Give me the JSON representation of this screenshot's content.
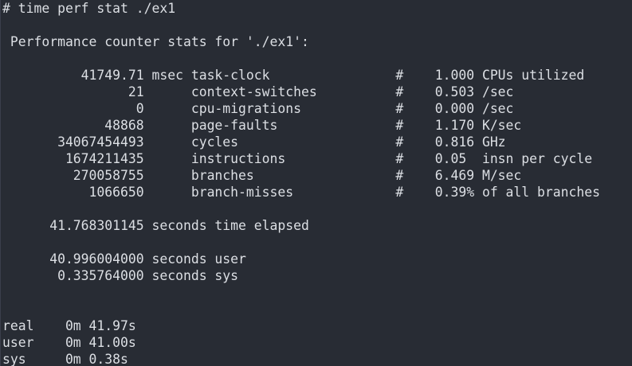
{
  "terminal": {
    "background": "#282c34",
    "foreground": "#dcdfe4",
    "lines": [
      "# time perf stat ./ex1",
      "",
      " Performance counter stats for './ex1':",
      "",
      "          41749.71 msec task-clock                #    1.000 CPUs utilized",
      "                21      context-switches          #    0.503 /sec",
      "                 0      cpu-migrations            #    0.000 /sec",
      "             48868      page-faults               #    1.170 K/sec",
      "       34067454493      cycles                    #    0.816 GHz",
      "        1674211435      instructions              #    0.05  insn per cycle",
      "         270058755      branches                  #    6.469 M/sec",
      "           1066650      branch-misses             #    0.39% of all branches",
      "",
      "      41.768301145 seconds time elapsed",
      "",
      "      40.996004000 seconds user",
      "       0.335764000 seconds sys",
      "",
      "",
      "real    0m 41.97s",
      "user    0m 41.00s",
      "sys     0m 0.38s"
    ]
  }
}
